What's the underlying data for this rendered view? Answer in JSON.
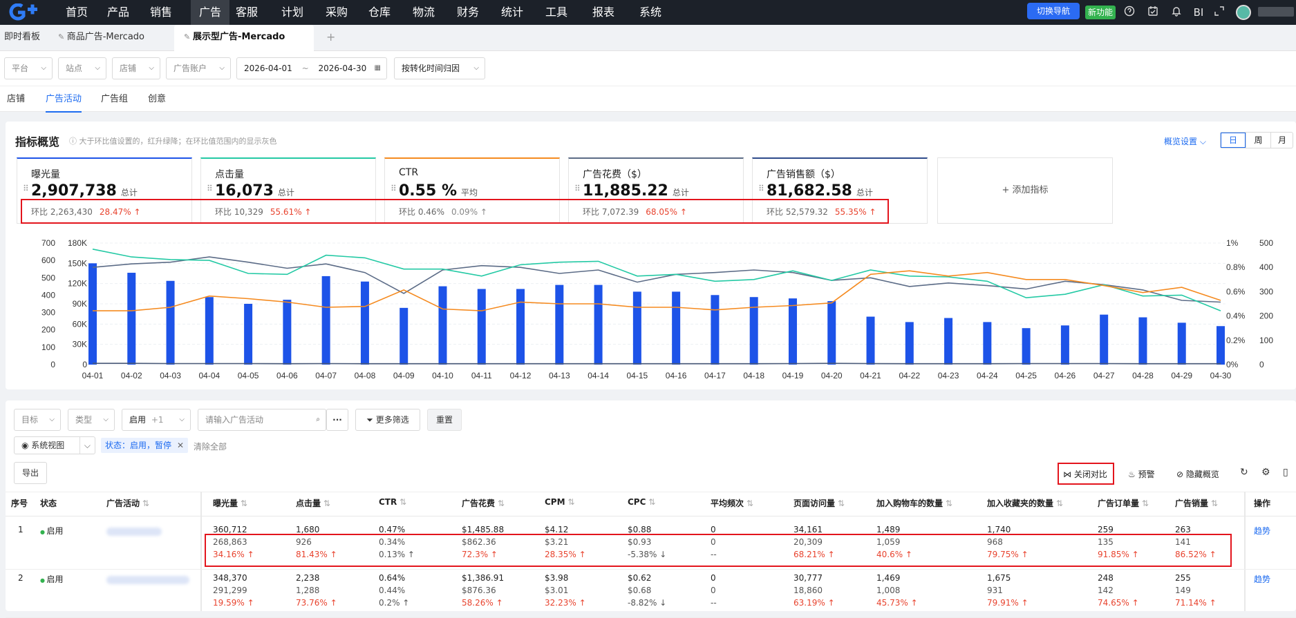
{
  "nav": {
    "items": [
      "首页",
      "产品",
      "销售",
      "广告",
      "客服",
      "计划",
      "采购",
      "仓库",
      "物流",
      "财务",
      "统计",
      "工具",
      "报表",
      "系统"
    ],
    "active_index": 3,
    "switch_nav": "切换导航",
    "new_feature": "新功能",
    "bi": "BI"
  },
  "tabs": [
    {
      "label": "即时看板",
      "active": false
    },
    {
      "label": "商品广告-Mercado",
      "active": false
    },
    {
      "label": "展示型广告-Mercado",
      "active": true
    }
  ],
  "tab_add": "+",
  "filters": {
    "platform": "平台",
    "site": "站点",
    "store": "店铺",
    "ad_account": "广告账户",
    "date_start": "2026-04-01",
    "date_sep": "~",
    "date_end": "2026-04-30",
    "attribution": "按转化时间归因"
  },
  "subtabs": [
    {
      "label": "店铺",
      "active": false
    },
    {
      "label": "广告活动",
      "active": true
    },
    {
      "label": "广告组",
      "active": false
    },
    {
      "label": "创意",
      "active": false
    }
  ],
  "overview": {
    "title": "指标概览",
    "hint": "大于环比值设置的，红升绿降；在环比值范围内的显示灰色",
    "settings": "概览设置",
    "period": [
      "日",
      "周",
      "月"
    ],
    "period_active": 0,
    "cards": [
      {
        "title": "曝光量",
        "value": "2,907,738",
        "suffix": "总计",
        "cmp_label": "环比",
        "cmp_value": "2,263,430",
        "pct": "28.47% ↑",
        "pct_color": "red"
      },
      {
        "title": "点击量",
        "value": "16,073",
        "suffix": "总计",
        "cmp_label": "环比",
        "cmp_value": "10,329",
        "pct": "55.61% ↑",
        "pct_color": "red"
      },
      {
        "title": "CTR",
        "value": "0.55 %",
        "suffix": "平均",
        "cmp_label": "环比",
        "cmp_value": "0.46%",
        "pct": "0.09% ↑",
        "pct_color": "gray"
      },
      {
        "title": "广告花费（$）",
        "value": "11,885.22",
        "suffix": "总计",
        "cmp_label": "环比",
        "cmp_value": "7,072.39",
        "pct": "68.05% ↑",
        "pct_color": "red"
      },
      {
        "title": "广告销售额（$）",
        "value": "81,682.58",
        "suffix": "总计",
        "cmp_label": "环比",
        "cmp_value": "52,579.32",
        "pct": "55.35% ↑",
        "pct_color": "red"
      }
    ],
    "add_metric": "+ 添加指标"
  },
  "chart_data": {
    "type": "bar",
    "categories": [
      "04-01",
      "04-02",
      "04-03",
      "04-04",
      "04-05",
      "04-06",
      "04-07",
      "04-08",
      "04-09",
      "04-10",
      "04-11",
      "04-12",
      "04-13",
      "04-14",
      "04-15",
      "04-16",
      "04-17",
      "04-18",
      "04-19",
      "04-20",
      "04-21",
      "04-22",
      "04-23",
      "04-24",
      "04-25",
      "04-26",
      "04-27",
      "04-28",
      "04-29",
      "04-30"
    ],
    "y_axes": {
      "left_outer": [
        "0",
        "100",
        "200",
        "300",
        "400",
        "500",
        "600",
        "700"
      ],
      "left_inner": [
        "0",
        "30K",
        "60K",
        "90K",
        "120K",
        "150K",
        "180K"
      ],
      "right_inner": [
        "0%",
        "0.2%",
        "0.4%",
        "0.6%",
        "0.8%",
        "1%"
      ],
      "right_outer": [
        "0",
        "100",
        "200",
        "300",
        "400",
        "500"
      ]
    },
    "series": [
      {
        "kind": "bar",
        "color": "#1d53e8",
        "axis": "left_inner",
        "values": [
          150000,
          136000,
          124000,
          100000,
          90000,
          96000,
          131000,
          123000,
          84000,
          116000,
          112000,
          112000,
          118000,
          118000,
          108000,
          108000,
          103000,
          100000,
          98000,
          94000,
          71000,
          63000,
          69000,
          63000,
          54000,
          58000,
          74000,
          70000,
          62000,
          57000
        ]
      },
      {
        "kind": "line",
        "color": "#5b6b86",
        "axis": "left_outer",
        "values": [
          560,
          580,
          590,
          620,
          590,
          555,
          580,
          530,
          410,
          545,
          570,
          560,
          525,
          545,
          475,
          520,
          530,
          545,
          530,
          485,
          500,
          450,
          470,
          455,
          435,
          480,
          460,
          430,
          370,
          360
        ]
      },
      {
        "kind": "line",
        "color": "#23c9a4",
        "axis": "left_outer",
        "values": [
          665,
          620,
          605,
          600,
          525,
          520,
          630,
          615,
          550,
          550,
          510,
          575,
          590,
          595,
          510,
          520,
          480,
          490,
          540,
          485,
          545,
          510,
          505,
          480,
          385,
          405,
          460,
          395,
          400,
          310
        ]
      },
      {
        "kind": "line",
        "color": "#f58a1f",
        "axis": "left_outer",
        "values": [
          310,
          310,
          330,
          395,
          380,
          360,
          330,
          335,
          430,
          320,
          310,
          360,
          350,
          350,
          330,
          330,
          315,
          330,
          340,
          355,
          520,
          540,
          510,
          530,
          490,
          490,
          455,
          415,
          445,
          370
        ]
      },
      {
        "kind": "line",
        "color": "#4a5a78",
        "axis": "left_outer",
        "values": [
          7,
          7,
          6,
          6,
          6,
          5,
          6,
          5,
          5,
          5,
          5,
          5,
          5,
          5,
          5,
          5,
          5,
          5,
          6,
          7,
          6,
          5,
          5,
          5,
          6,
          6,
          6,
          5,
          5,
          5
        ]
      }
    ]
  },
  "table_toolbar": {
    "goal": "目标",
    "type": "类型",
    "status_sel": "启用",
    "status_more": "+1",
    "search_placeholder": "请输入广告活动",
    "more_filter": "更多筛选",
    "reset": "重置",
    "sys_view": "系统视图",
    "status_tag": "状态：启用，暂停",
    "clear_all": "清除全部",
    "export": "导出",
    "close_compare": "关闭对比",
    "alert": "预警",
    "hide_overview": "隐藏概览"
  },
  "table": {
    "headers": [
      "序号",
      "状态",
      "广告活动",
      "曝光量",
      "点击量",
      "CTR",
      "广告花费",
      "CPM",
      "CPC",
      "平均频次",
      "页面访问量",
      "加入购物车的数量",
      "加入收藏夹的数量",
      "广告订单量",
      "广告销量",
      "操作"
    ],
    "rows": [
      {
        "index": "1",
        "status": "启用",
        "action": "趋势",
        "current": [
          "360,712",
          "1,680",
          "0.47%",
          "$1,485.88",
          "$4.12",
          "$0.88",
          "0",
          "34,161",
          "1,489",
          "1,740",
          "259",
          "263"
        ],
        "previous": [
          "268,863",
          "926",
          "0.34%",
          "$862.36",
          "$3.21",
          "$0.93",
          "0",
          "20,309",
          "1,059",
          "968",
          "135",
          "141"
        ],
        "change": [
          "34.16% ↑",
          "81.43% ↑",
          "0.13% ↑",
          "72.3% ↑",
          "28.35% ↑",
          "-5.38% ↓",
          "--",
          "68.21% ↑",
          "40.6% ↑",
          "79.75% ↑",
          "91.85% ↑",
          "86.52% ↑"
        ]
      },
      {
        "index": "2",
        "status": "启用",
        "action": "趋势",
        "current": [
          "348,370",
          "2,238",
          "0.64%",
          "$1,386.91",
          "$3.98",
          "$0.62",
          "0",
          "30,777",
          "1,469",
          "1,675",
          "248",
          "255"
        ],
        "previous": [
          "291,299",
          "1,288",
          "0.44%",
          "$876.36",
          "$3.01",
          "$0.68",
          "0",
          "18,860",
          "1,008",
          "931",
          "142",
          "149"
        ],
        "change": [
          "19.59% ↑",
          "73.76% ↑",
          "0.2% ↑",
          "58.26% ↑",
          "32.23% ↑",
          "-8.82% ↓",
          "--",
          "63.19% ↑",
          "45.73% ↑",
          "79.91% ↑",
          "74.65% ↑",
          "71.14% ↑"
        ]
      }
    ]
  },
  "colors": {
    "accent": "#1d6bf0",
    "up": "#e8432e",
    "highlight_box": "#e3141c",
    "status_on": "#33b24f"
  }
}
